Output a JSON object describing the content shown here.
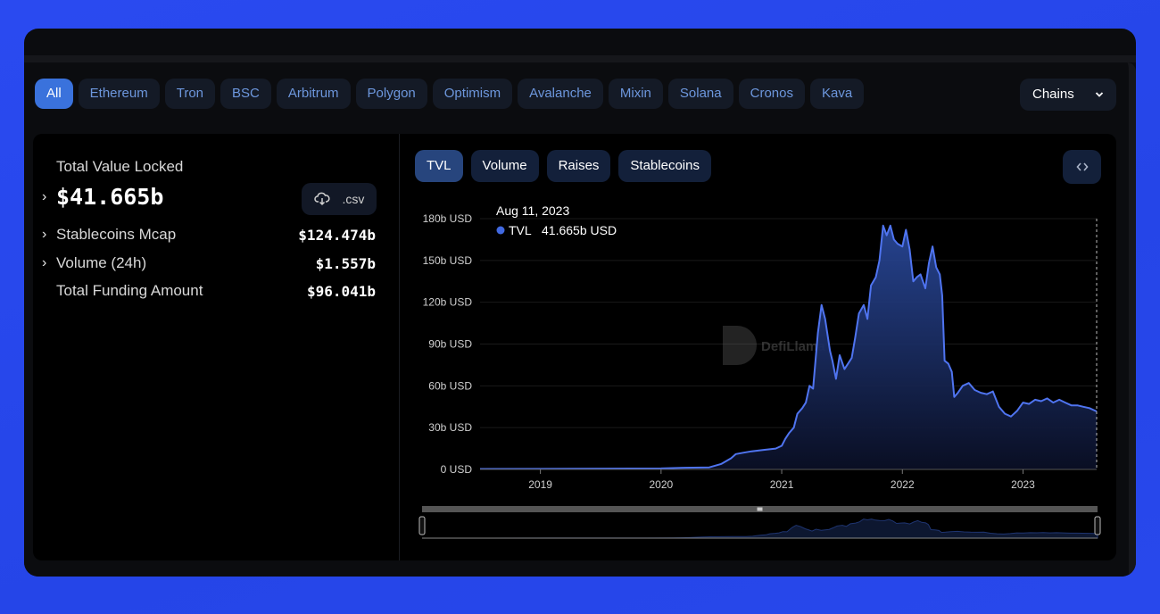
{
  "chains": {
    "items": [
      {
        "label": "All",
        "active": true
      },
      {
        "label": "Ethereum"
      },
      {
        "label": "Tron"
      },
      {
        "label": "BSC"
      },
      {
        "label": "Arbitrum"
      },
      {
        "label": "Polygon"
      },
      {
        "label": "Optimism"
      },
      {
        "label": "Avalanche"
      },
      {
        "label": "Mixin"
      },
      {
        "label": "Solana"
      },
      {
        "label": "Cronos"
      },
      {
        "label": "Kava"
      }
    ],
    "dropdown_label": "Chains"
  },
  "summary": {
    "tvl_label": "Total Value Locked",
    "tvl_value": "$41.665b",
    "csv_label": ".csv",
    "rows": [
      {
        "label": "Stablecoins Mcap",
        "value": "$124.474b",
        "expandable": true
      },
      {
        "label": "Volume (24h)",
        "value": "$1.557b",
        "expandable": true
      },
      {
        "label": "Total Funding Amount",
        "value": "$96.041b",
        "expandable": false
      }
    ]
  },
  "chart_tabs": [
    {
      "label": "TVL",
      "active": true
    },
    {
      "label": "Volume"
    },
    {
      "label": "Raises"
    },
    {
      "label": "Stablecoins"
    }
  ],
  "embed_icon": "code-brackets-icon",
  "watermark": "DefiLlama",
  "colors": {
    "accent": "#4169e1",
    "line": "#4f74f0",
    "active_chip": "#3a72dc",
    "background": "#2a4af0"
  },
  "chart_data": {
    "type": "area",
    "title": "",
    "series": [
      {
        "name": "TVL",
        "unit": "b USD",
        "x": [
          2018.5,
          2019.0,
          2019.5,
          2020.0,
          2020.2,
          2020.4,
          2020.5,
          2020.58,
          2020.62,
          2020.68,
          2020.75,
          2020.85,
          2020.95,
          2021.0,
          2021.03,
          2021.06,
          2021.1,
          2021.13,
          2021.17,
          2021.2,
          2021.23,
          2021.26,
          2021.3,
          2021.33,
          2021.36,
          2021.4,
          2021.42,
          2021.45,
          2021.48,
          2021.52,
          2021.55,
          2021.58,
          2021.61,
          2021.64,
          2021.68,
          2021.71,
          2021.74,
          2021.78,
          2021.81,
          2021.84,
          2021.87,
          2021.9,
          2021.93,
          2021.96,
          2022.0,
          2022.03,
          2022.06,
          2022.09,
          2022.12,
          2022.15,
          2022.19,
          2022.22,
          2022.25,
          2022.28,
          2022.31,
          2022.33,
          2022.35,
          2022.38,
          2022.41,
          2022.43,
          2022.46,
          2022.5,
          2022.55,
          2022.6,
          2022.65,
          2022.7,
          2022.75,
          2022.8,
          2022.85,
          2022.9,
          2022.95,
          2023.0,
          2023.05,
          2023.1,
          2023.15,
          2023.2,
          2023.25,
          2023.3,
          2023.35,
          2023.4,
          2023.45,
          2023.5,
          2023.55,
          2023.61
        ],
        "values": [
          0.3,
          0.4,
          0.6,
          0.7,
          1.2,
          1.5,
          4,
          8,
          11,
          12,
          13,
          14,
          15,
          17,
          22,
          26,
          30,
          40,
          44,
          48,
          60,
          58,
          98,
          118,
          108,
          85,
          78,
          65,
          82,
          72,
          76,
          80,
          95,
          112,
          118,
          108,
          132,
          138,
          150,
          175,
          168,
          175,
          165,
          162,
          160,
          172,
          158,
          135,
          138,
          140,
          130,
          148,
          160,
          145,
          140,
          125,
          78,
          76,
          70,
          52,
          55,
          60,
          62,
          57,
          55,
          54,
          56,
          45,
          40,
          38,
          42,
          48,
          47,
          50,
          49,
          51,
          48,
          50,
          48,
          46,
          46,
          45,
          44,
          41.665
        ]
      }
    ],
    "x_ticks": [
      "2019",
      "2020",
      "2021",
      "2022",
      "2023"
    ],
    "y_ticks": [
      "0 USD",
      "30b USD",
      "60b USD",
      "90b USD",
      "120b USD",
      "150b USD",
      "180b USD"
    ],
    "ylim": [
      0,
      180
    ],
    "xlabel": "",
    "ylabel": "",
    "grid": true,
    "tooltip": {
      "date": "Aug 11, 2023",
      "series": "TVL",
      "value": "41.665b USD"
    },
    "legend": "none",
    "has_zoom_slider": true
  }
}
